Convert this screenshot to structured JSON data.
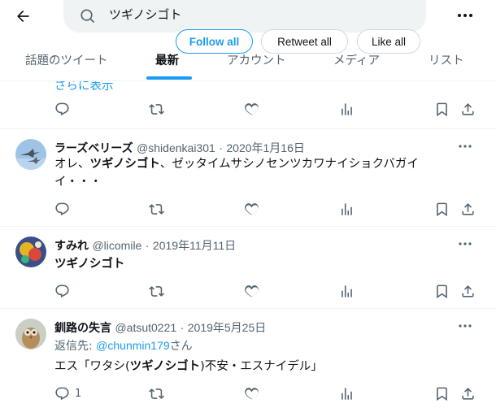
{
  "search": {
    "query": "ツギノシゴト"
  },
  "tabs": [
    {
      "label": "話題のツイート"
    },
    {
      "label": "最新"
    },
    {
      "label": "アカウント"
    },
    {
      "label": "メディア"
    },
    {
      "label": "リスト"
    }
  ],
  "pills": {
    "follow_all": "Follow all",
    "retweet_all": "Retweet all",
    "like_all": "Like all"
  },
  "first": {
    "show_more": "さらに表示"
  },
  "tweets": [
    {
      "name": "ラーズベリーズ",
      "handle": "@shidenkai301",
      "date": "2020年1月16日",
      "text_pre": "オレ、",
      "text_hl": "ツギノシゴト",
      "text_post": "、ゼッタイムサシノセンツカワナイショクバガイイ・・・"
    },
    {
      "name": "すみれ",
      "handle": "@licomile",
      "date": "2019年11月11日",
      "text_hl": "ツギノシゴト"
    },
    {
      "name": "釧路の失言",
      "handle": "@atsut0221",
      "date": "2019年5月25日",
      "reply_label": "返信先: ",
      "reply_handle": "@chunmin179",
      "reply_suffix": "さん",
      "text_pre": "エス「ワタシ(",
      "text_hl": "ツギノシゴト",
      "text_post": ")不安・エスナイデル」",
      "reply_count": "1"
    }
  ],
  "icons": [
    "back-arrow-icon",
    "search-icon",
    "more-icon",
    "reply-icon",
    "retweet-icon",
    "like-icon",
    "views-icon",
    "bookmark-icon",
    "share-icon"
  ],
  "colors": {
    "accent": "#1d9bf0",
    "muted": "#536471",
    "text": "#0f1419"
  }
}
